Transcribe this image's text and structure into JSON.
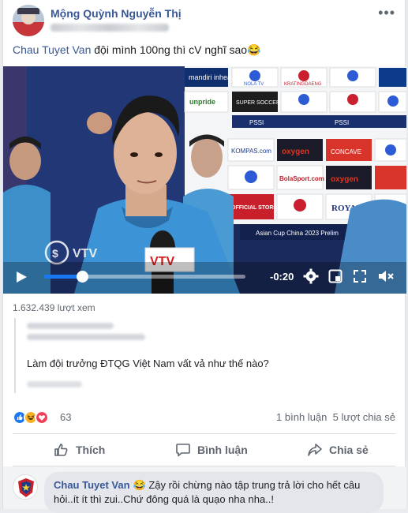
{
  "post": {
    "author": "Mộng Quỳnh Nguyễn Thị",
    "caption_mention": "Chau Tuyet Van",
    "caption_text": " đội mình 100ng thì cV nghĩ sao😂"
  },
  "video": {
    "time_remaining": "-0:20",
    "progress": 0.19,
    "sponsors": [
      "mandiri inhealth",
      "NOLA TV",
      "KRATINGDAENG",
      "unpride",
      "SUPER SOCCER",
      "KOMPAS.com",
      "oxygen",
      "CONCAVE",
      "BolaSport.com",
      "OFFICIAL STORE",
      "ROYAL",
      "PSSI"
    ],
    "banner": "Asian Cup China 2023 Prelim",
    "watermark": "VTV"
  },
  "views": "1.632.439 lượt xem",
  "quote": {
    "text": "Làm đội trưởng ĐTQG Việt Nam vất vả như thế nào?"
  },
  "stats": {
    "reaction_count": "63",
    "comments": "1 bình luận",
    "shares": "5 lượt chia sẻ"
  },
  "actions": {
    "like": "Thích",
    "comment": "Bình luận",
    "share": "Chia sẻ"
  },
  "comment": {
    "author": "Chau Tuyet Van",
    "text": "😂 Zậy rồi chừng nào tập trung trả lời cho hết câu hỏi..ít ít thì zui..Chứ đông quá là quạo nha nha..!"
  },
  "colors": {
    "link": "#385898",
    "like_blue": "#1877f2",
    "love_red": "#f33e58",
    "haha_yellow": "#f7b125"
  }
}
